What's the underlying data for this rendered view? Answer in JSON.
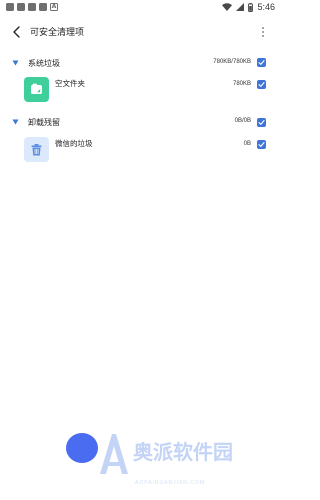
{
  "status_bar": {
    "time": "5:46",
    "notification_icons": [
      "notification-icon",
      "notification-icon",
      "notification-icon",
      "notification-icon",
      "a-badge-icon"
    ],
    "a_badge": "A"
  },
  "header": {
    "title": "可安全清理项"
  },
  "groups": [
    {
      "title": "系统垃圾",
      "size": "780KB/780KB",
      "checked": true,
      "items": [
        {
          "label": "空文件夹",
          "size": "780KB",
          "icon": "folder-icon",
          "icon_color": "#3ecf9a",
          "checked": true
        }
      ]
    },
    {
      "title": "卸载残留",
      "size": "0B/0B",
      "checked": true,
      "items": [
        {
          "label": "微信的垃圾",
          "size": "0B",
          "icon": "wechat-trash-icon",
          "icon_color": "#dce8fb",
          "checked": true
        }
      ]
    }
  ],
  "watermark": {
    "text": "奥派软件园",
    "sub": "AOPAIRUANJIAN.COM"
  },
  "colors": {
    "accent": "#3f75d9",
    "fab": "#4a6cf0"
  }
}
